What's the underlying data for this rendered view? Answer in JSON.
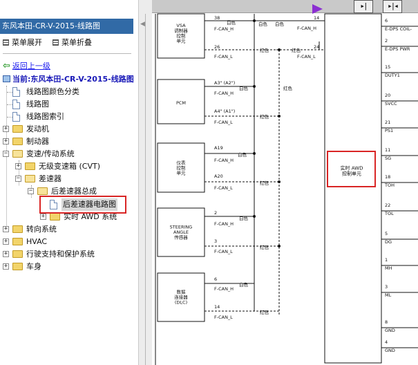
{
  "sidebar": {
    "title": "东风本田-CR-V-2015-线路图",
    "menu_expand": "菜单展开",
    "menu_collapse": "菜单折叠",
    "back": "返回上一级",
    "current": "当前:东风本田-CR-V-2015-线路图",
    "tree": [
      {
        "label": "线路图颜色分类"
      },
      {
        "label": "线路图"
      },
      {
        "label": "线路图索引"
      },
      {
        "label": "发动机"
      },
      {
        "label": "制动器"
      },
      {
        "label": "变速/传动系统"
      },
      {
        "label": "无级变速箱 (CVT)"
      },
      {
        "label": "差速器"
      },
      {
        "label": "后差速器总成"
      },
      {
        "label": "后差速器电路图"
      },
      {
        "label": "实时 AWD 系统"
      },
      {
        "label": "转向系统"
      },
      {
        "label": "HVAC"
      },
      {
        "label": "行驶支持和保护系统"
      },
      {
        "label": "车身"
      }
    ]
  },
  "toolbar": {
    "icon_prev": "prev-page-icon",
    "icon_fit": "fit-page-icon",
    "accent": "#8b2fd1"
  },
  "diagram": {
    "modules": [
      {
        "name": "VSA\n调制器\n控制\n单元"
      },
      {
        "name": "PCM"
      },
      {
        "name": "仪表\n控制\n单元"
      },
      {
        "name": "STEERING\nANGLE\n传感器"
      },
      {
        "name": "数据\n连接器\n(DLC)"
      }
    ],
    "pins": {
      "vsa_h": "38",
      "vsa_l": "26",
      "pcm_h": "A3\" (A2\")",
      "pcm_l": "A4\" (A1\")",
      "meter_h": "A19",
      "meter_l": "A20",
      "steer_h": "2",
      "steer_l": "3",
      "dlc_h": "6",
      "dlc_l": "14",
      "awd_top": "14",
      "awd_l": "24"
    },
    "signals": {
      "can_h": "F-CAN_H",
      "can_l": "F-CAN_L"
    },
    "wire_colors": {
      "white": "白色",
      "red": "红色"
    },
    "awd_unit": "实时 AWD\n控制单元",
    "right_pins": [
      {
        "num": "6",
        "name": "E-DPS COIL-"
      },
      {
        "num": "2",
        "name": "E-DPS PWR"
      },
      {
        "num": "15",
        "name": "DUTY1"
      },
      {
        "num": "20",
        "name": "SVCC"
      },
      {
        "num": "21",
        "name": "PS1"
      },
      {
        "num": "11",
        "name": "SG"
      },
      {
        "num": "18",
        "name": "TOH"
      },
      {
        "num": "22",
        "name": "TOL"
      },
      {
        "num": "5",
        "name": "DG"
      },
      {
        "num": "1",
        "name": "MH"
      },
      {
        "num": "3",
        "name": "ML"
      },
      {
        "num": "8",
        "name": "GND"
      },
      {
        "num": "4",
        "name": "GND"
      }
    ],
    "highlight_color": "#d92525"
  }
}
